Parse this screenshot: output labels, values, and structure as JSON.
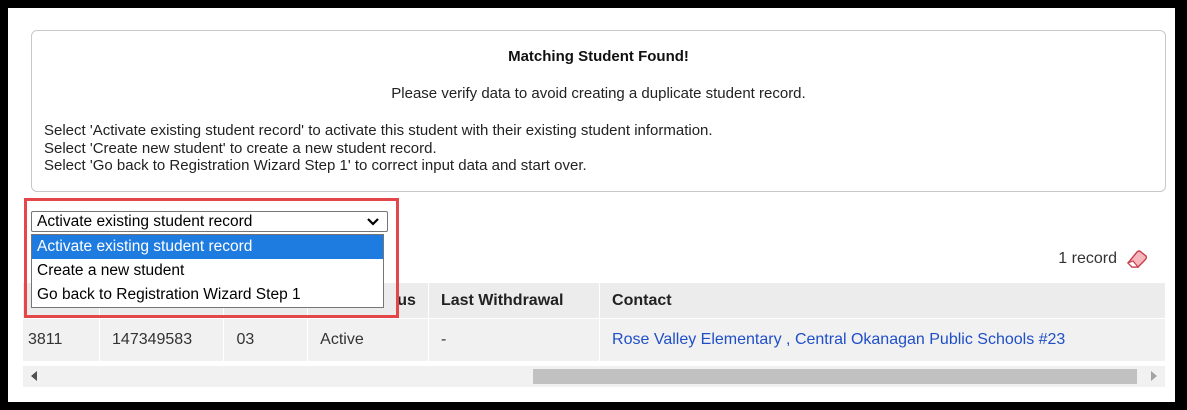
{
  "notice": {
    "title": "Matching Student Found!",
    "subtitle": "Please verify data to avoid creating a duplicate student record.",
    "lines": [
      "Select 'Activate existing student record' to activate this student with their existing student information.",
      "Select 'Create new student' to create a new student record.",
      "Select 'Go back to Registration Wizard Step 1' to correct input data and start over."
    ]
  },
  "action_select": {
    "value": "Activate existing student record",
    "options": [
      "Activate existing student record",
      "Create a new student",
      "Go back to Registration Wizard Step 1"
    ]
  },
  "record_count": "1 record",
  "table": {
    "headers": [
      "",
      "",
      "",
      "us",
      "Last Withdrawal",
      "Contact"
    ],
    "row": {
      "id": "3811",
      "number": "147349583",
      "grade": "03",
      "status": "Active",
      "last_withdrawal": "-",
      "school": "Rose Valley Elementary",
      "separator": " , ",
      "district": "Central Okanagan Public Schools #23"
    }
  },
  "colors": {
    "highlight": "#e3474a",
    "selected_option": "#1e7be0",
    "link": "#1f4fc7"
  },
  "icons": [
    "chevron-down-icon",
    "eraser-icon",
    "scroll-left-arrow",
    "scroll-right-arrow"
  ]
}
